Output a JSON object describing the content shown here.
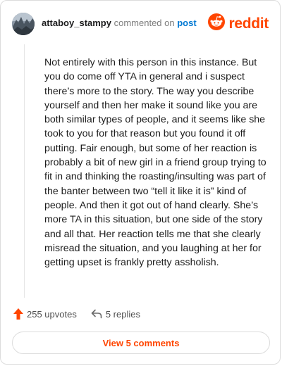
{
  "header": {
    "username": "attaboy_stampy",
    "commented_text": "commented on",
    "post_link": "post",
    "brand": "reddit"
  },
  "comment": {
    "text": "Not entirely with this person in this instance. But you do come off YTA in general and i suspect there’s more to the story. The way you describe yourself and then her make it sound like you are both similar types of people, and it seems like she took to you for that reason but you found it off putting. Fair enough, but some of her reaction is probably a bit of new girl in a friend group trying to fit in and thinking the roasting/insulting was part of the banter between two “tell it like it is” kind of people. And then it got out of hand clearly. She’s more TA in this situation, but one side of the story and all that. Her reaction tells me that she clearly misread the situation, and you laughing at her for getting upset is frankly pretty assholish."
  },
  "actions": {
    "upvotes": "255 upvotes",
    "replies": "5 replies"
  },
  "view_comments": "View 5 comments",
  "colors": {
    "brand": "#ff4500",
    "link": "#0079d3"
  },
  "icons": [
    "avatar",
    "reddit-logo-icon",
    "upvote-arrow-icon",
    "reply-arrow-icon"
  ]
}
